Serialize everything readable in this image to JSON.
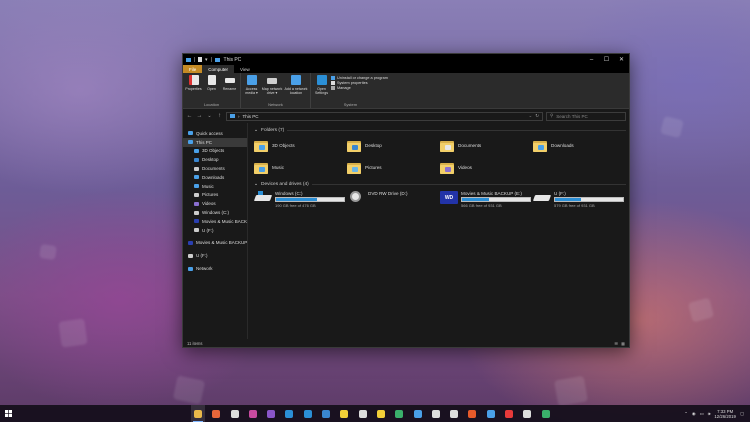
{
  "window": {
    "title": "This PC",
    "controls": [
      "–",
      "☐",
      "✕"
    ]
  },
  "ribbon": {
    "tabs": [
      "File",
      "Computer",
      "View"
    ],
    "groups": [
      {
        "label": "Location",
        "buttons": [
          "Properties",
          "Open",
          "Rename"
        ]
      },
      {
        "label": "Network",
        "buttons": [
          "Access media ▾",
          "Map network drive ▾",
          "Add a network location"
        ]
      },
      {
        "label": "System",
        "buttons": [
          "Open Settings"
        ],
        "rows": [
          "Uninstall or change a program",
          "System properties",
          "Manage"
        ]
      }
    ]
  },
  "navbar": {
    "breadcrumb_root": "›",
    "breadcrumb": "This PC",
    "search_placeholder": "Search This PC"
  },
  "sidebar": {
    "items": [
      {
        "label": "Quick access",
        "sub": false,
        "color": "#4aa0e8",
        "icon": "star-icon"
      },
      {
        "label": "This PC",
        "sub": false,
        "color": "#4aa0e8",
        "icon": "computer-icon",
        "selected": true
      },
      {
        "label": "3D Objects",
        "sub": true,
        "color": "#4aa0e8",
        "icon": "cube-icon"
      },
      {
        "label": "Desktop",
        "sub": true,
        "color": "#3a86d0",
        "icon": "desktop-icon"
      },
      {
        "label": "Documents",
        "sub": true,
        "color": "#cccccc",
        "icon": "documents-icon"
      },
      {
        "label": "Downloads",
        "sub": true,
        "color": "#4aa0e8",
        "icon": "download-icon"
      },
      {
        "label": "Music",
        "sub": true,
        "color": "#4aa0e8",
        "icon": "music-icon"
      },
      {
        "label": "Pictures",
        "sub": true,
        "color": "#cccccc",
        "icon": "pictures-icon"
      },
      {
        "label": "Videos",
        "sub": true,
        "color": "#8a6fd0",
        "icon": "videos-icon"
      },
      {
        "label": "Windows (C:)",
        "sub": true,
        "color": "#cccccc",
        "icon": "drive-icon"
      },
      {
        "label": "Movies & Music BACKUP",
        "sub": true,
        "color": "#2a3fb0",
        "icon": "wd-drive-icon"
      },
      {
        "label": "U (F:)",
        "sub": true,
        "color": "#cccccc",
        "icon": "usb-drive-icon"
      },
      {
        "label": "Movies & Music BACKUP (E:)",
        "sub": false,
        "color": "#2a3fb0",
        "icon": "wd-drive-icon",
        "gap": true
      },
      {
        "label": "U (F:)",
        "sub": false,
        "color": "#cccccc",
        "icon": "usb-drive-icon",
        "gap": true
      },
      {
        "label": "Network",
        "sub": false,
        "color": "#4aa0e8",
        "icon": "network-icon",
        "gap": true
      }
    ]
  },
  "folders_section": {
    "label": "Folders (7)"
  },
  "folders": [
    {
      "label": "3D Objects",
      "badge": "#4aa0e8",
      "icon": "3d-objects-folder-icon"
    },
    {
      "label": "Desktop",
      "badge": "#3a86d0",
      "icon": "desktop-folder-icon"
    },
    {
      "label": "Documents",
      "badge": "#e8e8e8",
      "icon": "documents-folder-icon"
    },
    {
      "label": "Downloads",
      "badge": "#4aa0e8",
      "icon": "downloads-folder-icon"
    },
    {
      "label": "Music",
      "badge": "#4aa0e8",
      "icon": "music-folder-icon"
    },
    {
      "label": "Pictures",
      "badge": "#6bb7e8",
      "icon": "pictures-folder-icon"
    },
    {
      "label": "Videos",
      "badge": "#8a6fd0",
      "icon": "videos-folder-icon"
    }
  ],
  "devices_section": {
    "label": "Devices and drives (4)"
  },
  "drives": [
    {
      "label": "Windows (C:)",
      "free": "190 GB free of 476 GB",
      "used": 0.6,
      "icon": "windows-drive-icon",
      "has_bar": true
    },
    {
      "label": "DVD RW Drive (D:)",
      "free": "",
      "used": 0,
      "icon": "dvd-drive-icon",
      "has_bar": false
    },
    {
      "label": "Movies & Music BACKUP (E:)",
      "free": "566 GB free of 931 GB",
      "used": 0.39,
      "icon": "wd-drive-icon",
      "has_bar": true
    },
    {
      "label": "U (F:)",
      "free": "579 GB free of 931 GB",
      "used": 0.38,
      "icon": "usb-drive-icon",
      "has_bar": true
    }
  ],
  "status": {
    "items": "11 items"
  },
  "taskbar": {
    "apps": [
      {
        "name": "file-explorer-app",
        "color": "#e8b84a",
        "active": true
      },
      {
        "name": "firefox-app",
        "color": "#e8663a"
      },
      {
        "name": "mail-app",
        "color": "#dddddd"
      },
      {
        "name": "messages-app",
        "color": "#c94aa0"
      },
      {
        "name": "email-app",
        "color": "#8a56c9"
      },
      {
        "name": "chat-app",
        "color": "#2b8fd6"
      },
      {
        "name": "store-app",
        "color": "#2b8fd6"
      },
      {
        "name": "people-app",
        "color": "#3a86d0"
      },
      {
        "name": "sticky-notes-app",
        "color": "#f2cf38"
      },
      {
        "name": "calculator-app",
        "color": "#dddddd"
      },
      {
        "name": "notes-app",
        "color": "#f2cf38"
      },
      {
        "name": "maps-app",
        "color": "#3ab06b"
      },
      {
        "name": "photos-app",
        "color": "#4aa0e8"
      },
      {
        "name": "weather-app",
        "color": "#dddddd"
      },
      {
        "name": "settings-app",
        "color": "#dddddd"
      },
      {
        "name": "media-app",
        "color": "#e85a2a"
      },
      {
        "name": "podcast-app",
        "color": "#4aa0e8"
      },
      {
        "name": "youtube-app",
        "color": "#e83a3a"
      },
      {
        "name": "music-app",
        "color": "#dddddd"
      },
      {
        "name": "xbox-app",
        "color": "#3ab06b"
      }
    ],
    "time": "7:33 PM",
    "date": "12/26/2019"
  }
}
